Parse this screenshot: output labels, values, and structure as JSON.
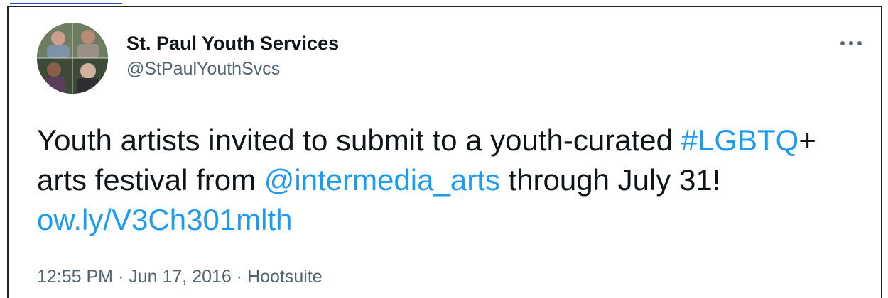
{
  "tweet": {
    "display_name": "St. Paul Youth Services",
    "handle": "@StPaulYouthSvcs",
    "text": {
      "part1": "Youth artists invited to submit to a youth-curated",
      "hashtag": "#LGBTQ",
      "part2": "+ arts festival from",
      "mention": "@intermedia_arts",
      "part3": "through July 31!",
      "url": "ow.ly/V3Ch301mlth"
    },
    "meta": {
      "time": "12:55 PM",
      "separator": "·",
      "date": "Jun 17, 2016",
      "source": "Hootsuite"
    },
    "more_icon": "more-horizontal-icon"
  },
  "colors": {
    "link": "#1d9bf0",
    "text": "#0f1419",
    "secondary": "#536471"
  }
}
